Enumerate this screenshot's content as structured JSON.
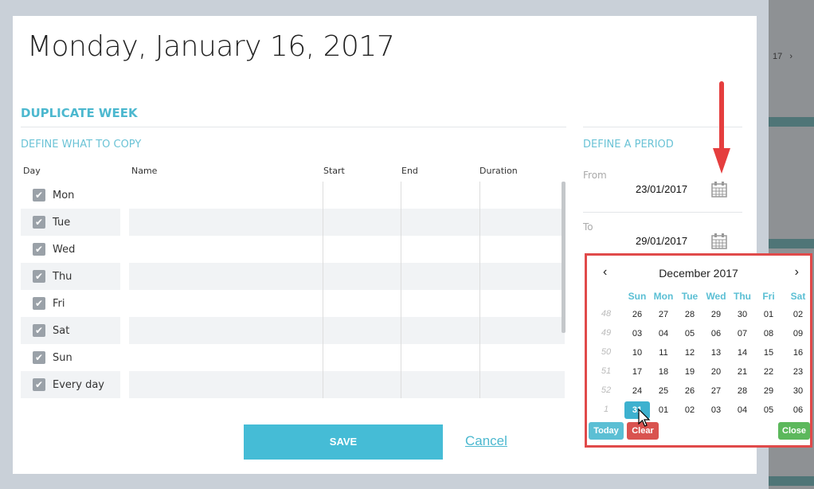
{
  "background": {
    "fragment": "17",
    "chevron": "›"
  },
  "modal": {
    "title": "Monday, January 16, 2017",
    "section_title": "DUPLICATE WEEK",
    "copy_title": "DEFINE WHAT TO COPY",
    "columns": [
      "Day",
      "Name",
      "Start",
      "End",
      "Duration"
    ],
    "days": [
      {
        "label": "Mon",
        "checked": true
      },
      {
        "label": "Tue",
        "checked": true
      },
      {
        "label": "Wed",
        "checked": true
      },
      {
        "label": "Thu",
        "checked": true
      },
      {
        "label": "Fri",
        "checked": true
      },
      {
        "label": "Sat",
        "checked": true
      },
      {
        "label": "Sun",
        "checked": true
      },
      {
        "label": "Every day",
        "checked": true
      }
    ],
    "save_label": "SAVE",
    "cancel_label": "Cancel",
    "period": {
      "title": "DEFINE A PERIOD",
      "from_label": "From",
      "from_value": "23/01/2017",
      "to_label": "To",
      "to_value": "29/01/2017"
    }
  },
  "datepicker": {
    "month_label": "December 2017",
    "prev": "‹",
    "next": "›",
    "weekdays": [
      "Sun",
      "Mon",
      "Tue",
      "Wed",
      "Thu",
      "Fri",
      "Sat"
    ],
    "weeks": [
      {
        "num": "48",
        "days": [
          "26",
          "27",
          "28",
          "29",
          "30",
          "01",
          "02"
        ]
      },
      {
        "num": "49",
        "days": [
          "03",
          "04",
          "05",
          "06",
          "07",
          "08",
          "09"
        ]
      },
      {
        "num": "50",
        "days": [
          "10",
          "11",
          "12",
          "13",
          "14",
          "15",
          "16"
        ]
      },
      {
        "num": "51",
        "days": [
          "17",
          "18",
          "19",
          "20",
          "21",
          "22",
          "23"
        ]
      },
      {
        "num": "52",
        "days": [
          "24",
          "25",
          "26",
          "27",
          "28",
          "29",
          "30"
        ]
      },
      {
        "num": "1",
        "days": [
          "31",
          "01",
          "02",
          "03",
          "04",
          "05",
          "06"
        ]
      }
    ],
    "selected": "31",
    "today_label": "Today",
    "clear_label": "Clear",
    "close_label": "Close",
    "colors": {
      "accent": "#3db1cf",
      "today": "#5bbfd4",
      "clear": "#d9534f",
      "close": "#5cb85c",
      "highlight_border": "#e04a4a"
    }
  }
}
